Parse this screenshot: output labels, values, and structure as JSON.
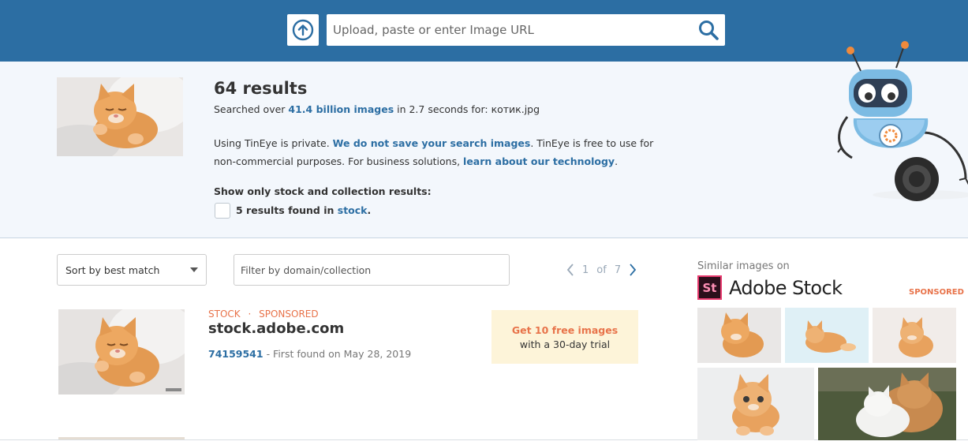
{
  "header": {
    "search_placeholder": "Upload, paste or enter Image URL"
  },
  "summary": {
    "results_title": "64 results",
    "searched_prefix": "Searched over ",
    "searched_count": "41.4 billion images",
    "searched_mid": " in 2.7 seconds for: ",
    "searched_file": "котик.jpg",
    "private_a": "Using TinEye is private. ",
    "private_link": "We do not save your search images",
    "private_b": ". TinEye is free to use for non-commercial purposes. For business solutions, ",
    "business_link": "learn about our technology",
    "private_c": ".",
    "stock_heading": "Show only stock and collection results:",
    "stock_found": "5 results found in ",
    "stock_link": "stock",
    "stock_end": "."
  },
  "controls": {
    "sort_label": "Sort by best match",
    "filter_placeholder": "Filter by domain/collection",
    "page_current": "1",
    "page_of": "of",
    "page_total": "7"
  },
  "result": {
    "tag_stock": "STOCK",
    "tag_sep": "·",
    "tag_sponsored": "SPONSORED",
    "domain": "stock.adobe.com",
    "id": "74159541",
    "first_found": " - First found on May 28, 2019",
    "promo_title": "Get 10 free images",
    "promo_sub": "with a 30-day trial"
  },
  "sidebar": {
    "similar_label": "Similar images on",
    "logo_badge": "St",
    "logo_text": "Adobe Stock",
    "sponsored": "SPONSORED"
  },
  "colors": {
    "header_blue": "#2c6ea3",
    "link_blue": "#2c6ea3",
    "accent_orange": "#e8734a",
    "promo_bg": "#fdf4d9",
    "summary_bg": "#f3f7fc"
  },
  "icons": {
    "upload": "upload-arrow-icon",
    "search": "magnifier-icon",
    "sort": "caret-down-icon",
    "prev": "chevron-left-icon",
    "next": "chevron-right-icon"
  }
}
